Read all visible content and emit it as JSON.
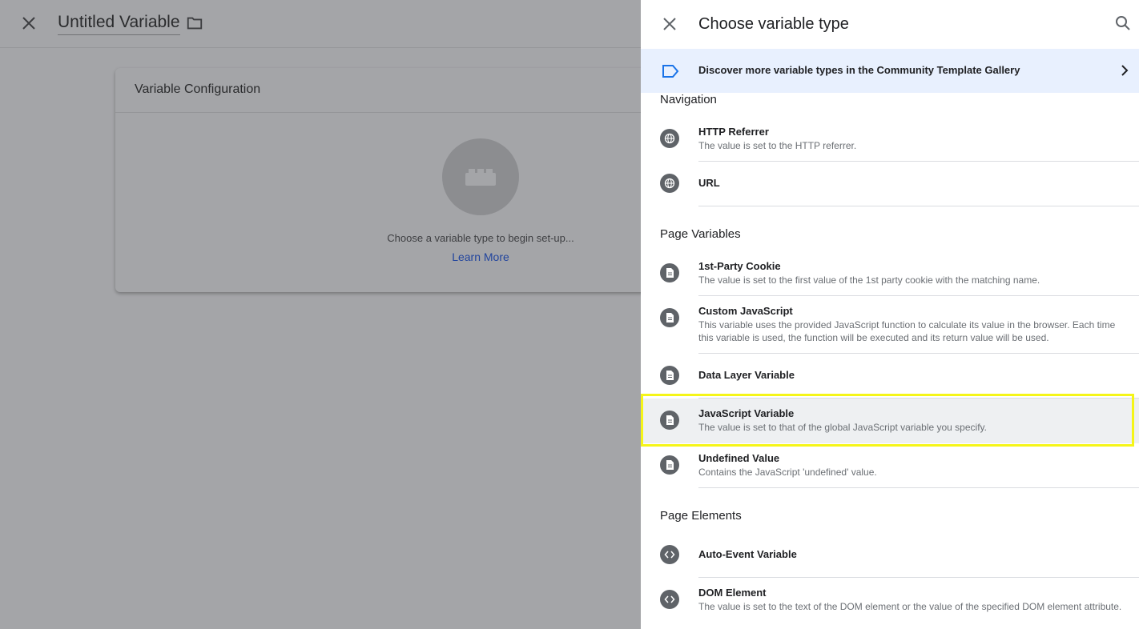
{
  "background": {
    "variable_title": "Untitled Variable",
    "card_title": "Variable Configuration",
    "card_hint": "Choose a variable type to begin set-up...",
    "card_link": "Learn More"
  },
  "panel": {
    "title": "Choose variable type",
    "gallery_text": "Discover more variable types in the Community Template Gallery",
    "sections": [
      {
        "title": "Navigation"
      },
      {
        "title": "Page Variables"
      },
      {
        "title": "Page Elements"
      }
    ],
    "items": [
      {
        "name": "HTTP Referrer",
        "desc": "The value is set to the HTTP referrer.",
        "icon": "globe-icon"
      },
      {
        "name": "URL",
        "desc": "",
        "icon": "globe-icon"
      },
      {
        "name": "1st-Party Cookie",
        "desc": "The value is set to the first value of the 1st party cookie with the matching name.",
        "icon": "document-icon"
      },
      {
        "name": "Custom JavaScript",
        "desc": "This variable uses the provided JavaScript function to calculate its value in the browser. Each time this variable is used, the function will be executed and its return value will be used.",
        "icon": "document-icon"
      },
      {
        "name": "Data Layer Variable",
        "desc": "",
        "icon": "document-icon"
      },
      {
        "name": "JavaScript Variable",
        "desc": "The value is set to that of the global JavaScript variable you specify.",
        "icon": "document-icon"
      },
      {
        "name": "Undefined Value",
        "desc": "Contains the JavaScript 'undefined' value.",
        "icon": "document-icon"
      },
      {
        "name": "Auto-Event Variable",
        "desc": "",
        "icon": "code-icon"
      },
      {
        "name": "DOM Element",
        "desc": "The value is set to the text of the DOM element or the value of the specified DOM element attribute.",
        "icon": "code-icon"
      }
    ]
  },
  "colors": {
    "highlight_border": "#f5f518",
    "gallery_background": "#e8f0fe",
    "accent_link": "#22459e"
  }
}
